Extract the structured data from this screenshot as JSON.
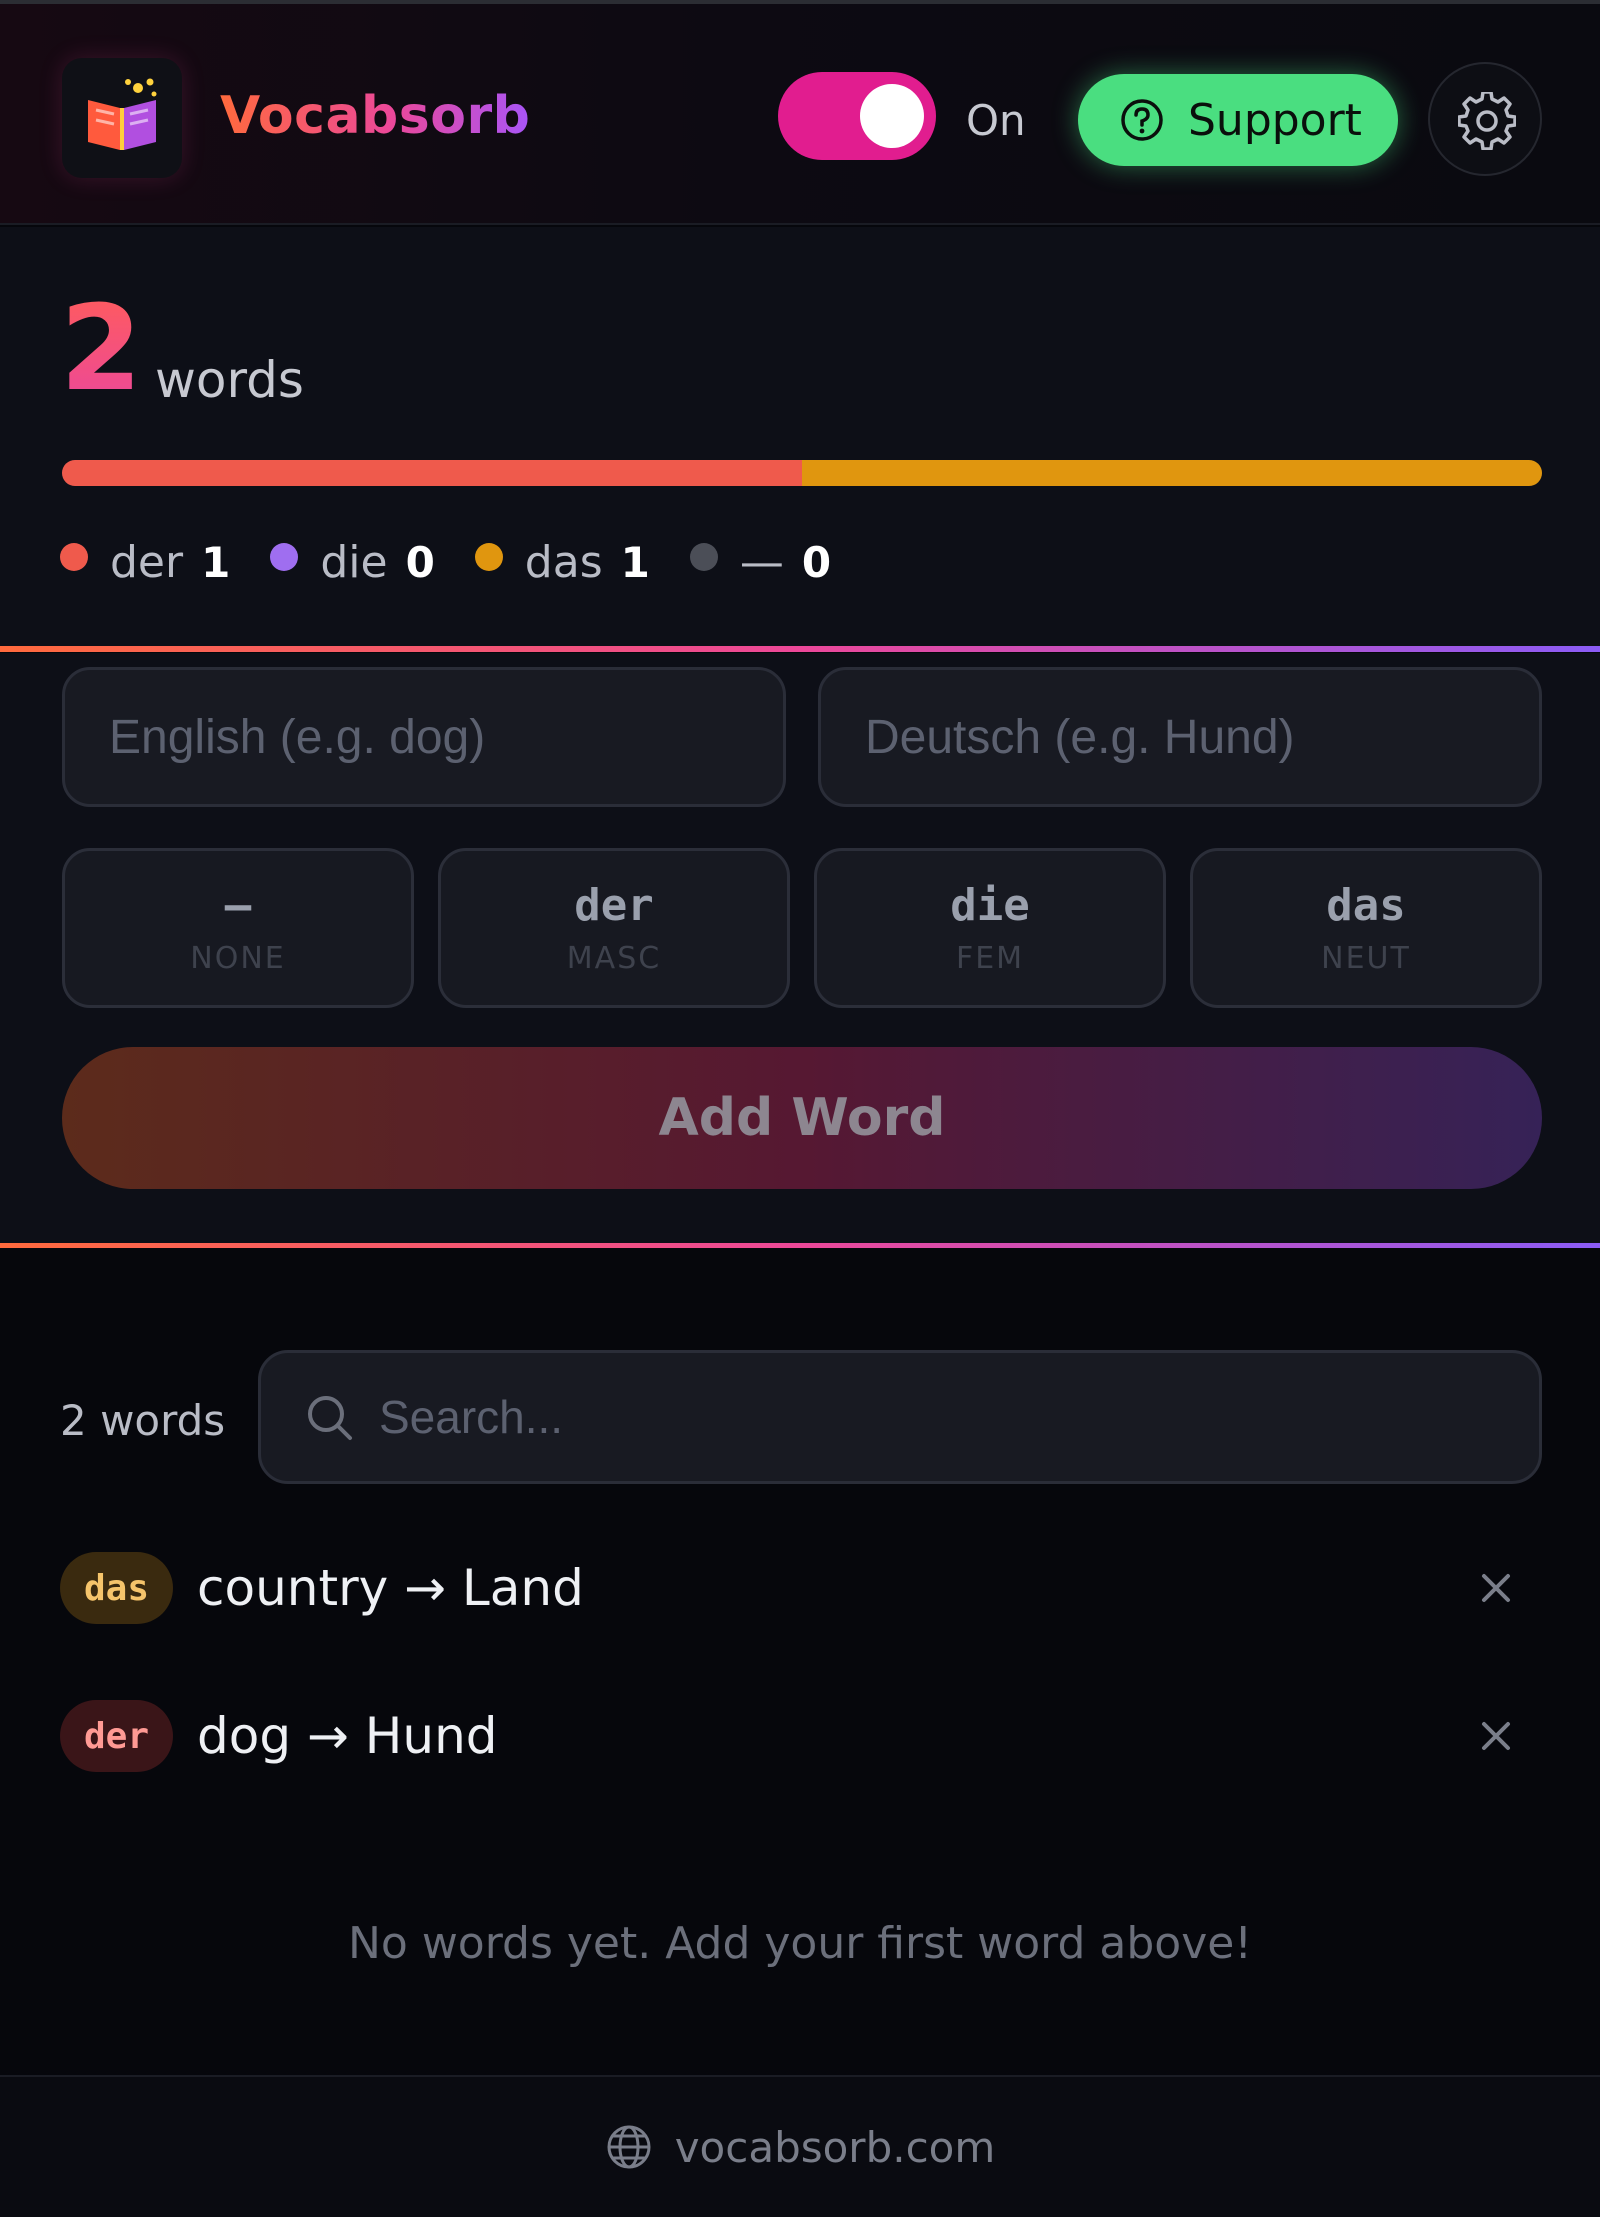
{
  "header": {
    "brand": "Vocabsorb",
    "toggle_label": "On",
    "toggle_on": true,
    "support_label": "Support"
  },
  "stats": {
    "total": "2",
    "total_label": "words",
    "legend": [
      {
        "name": "der",
        "count": "1",
        "color": "#ef5a4c"
      },
      {
        "name": "die",
        "count": "0",
        "color": "#9f6ef0"
      },
      {
        "name": "das",
        "count": "1",
        "color": "#e0960f"
      },
      {
        "name": "—",
        "count": "0",
        "color": "#4b4e57"
      }
    ]
  },
  "form": {
    "english_placeholder": "English (e.g. dog)",
    "german_placeholder": "Deutsch (e.g. Hund)",
    "articles": [
      {
        "main": "—",
        "sub": "NONE",
        "active": true
      },
      {
        "main": "der",
        "sub": "MASC",
        "active": false
      },
      {
        "main": "die",
        "sub": "FEM",
        "active": false
      },
      {
        "main": "das",
        "sub": "NEUT",
        "active": false
      }
    ],
    "add_label": "Add Word"
  },
  "list": {
    "count_label": "2 words",
    "search_placeholder": "Search...",
    "words": [
      {
        "article": "das",
        "text": "country → Land"
      },
      {
        "article": "der",
        "text": "dog → Hund"
      }
    ],
    "empty_message": "No words yet. Add your first word above!"
  },
  "footer": {
    "link": "vocabsorb.com"
  }
}
